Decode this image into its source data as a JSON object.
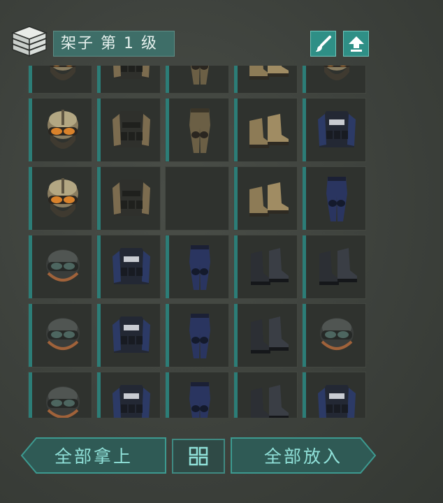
{
  "container": {
    "title": "架子 第 1 级",
    "icon": "crate-stack-icon"
  },
  "header_buttons": [
    {
      "name": "paint-brush-button",
      "icon": "paint-brush-icon"
    },
    {
      "name": "upgrade-button",
      "icon": "upload-arrow-icon"
    }
  ],
  "slots": [
    "goggle-helmet",
    "tactical-vest",
    "camo-pants",
    "tan-boots",
    "goggle-helmet",
    "goggle-helmet",
    "tactical-vest",
    "camo-pants",
    "tan-boots",
    "police-vest",
    "goggle-helmet",
    "tactical-vest",
    "",
    "tan-boots",
    "navy-pants",
    "black-helmet",
    "police-vest",
    "navy-pants",
    "black-boots",
    "black-boots",
    "black-helmet",
    "police-vest",
    "navy-pants",
    "black-boots",
    "black-helmet",
    "black-helmet",
    "police-vest",
    "navy-pants",
    "black-boots",
    "police-vest"
  ],
  "actions": {
    "take_all": "全部拿上",
    "put_all": "全部放入",
    "layout_toggle_icon": "grid-layout-icon"
  },
  "colors": {
    "accent": "#2f8f86",
    "slot_bar": "#2c7d77",
    "button_text": "#8fe0d8"
  }
}
